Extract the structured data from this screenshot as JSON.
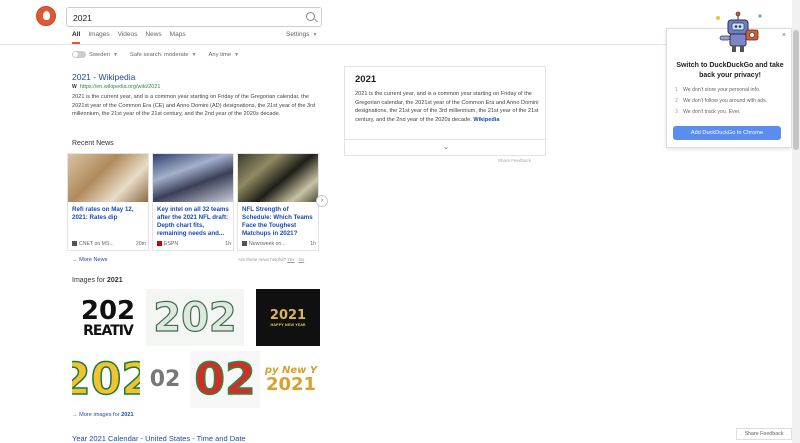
{
  "header": {
    "search_value": "2021",
    "tabs": [
      "All",
      "Images",
      "Videos",
      "News",
      "Maps"
    ],
    "settings_label": "Settings"
  },
  "filters": {
    "region": "Sweden",
    "safe_search": "Safe search: moderate",
    "time": "Any time"
  },
  "result": {
    "title": "2021 - Wikipedia",
    "url": "https://en.wikipedia.org/wiki/2021",
    "wiki_mark": "W",
    "snippet": "2021 is the current year, and is a common year starting on Friday of the Gregorian calendar, the 2021st year of the Common Era (CE) and Anno Domini (AD) designations, the 21st year of the 3rd millennium, the 21st year of the 21st century, and the 2nd year of the 2020s decade."
  },
  "news": {
    "section_title": "Recent News",
    "items": [
      {
        "title": "Refi rates on May 12, 2021: Rates dip",
        "source": "CNET on MS...",
        "age": "20m"
      },
      {
        "title": "Key intel on all 32 teams after the 2021 NFL draft: Depth chart fits, remaining needs and...",
        "source": "ESPN",
        "age": "1h"
      },
      {
        "title": "NFL Strength of Schedule: Which Teams Face the Toughest Matchups in 2021?",
        "source": "Newsweek on...",
        "age": "1h"
      }
    ],
    "more_label": "More News",
    "helpful_text": "Are these news helpful?",
    "helpful_yes": "Yes",
    "helpful_no": "No"
  },
  "images": {
    "section_prefix": "Images for ",
    "section_query": "2021",
    "more_prefix": "More images for ",
    "more_query": "2021",
    "tiles": [
      "202",
      "REATIV",
      "202",
      "2021",
      "HAPPY NEW YEAR",
      "202",
      "02",
      "02",
      "py New Y",
      "2021"
    ]
  },
  "infobox": {
    "title": "2021",
    "text": "2021 is the current year, and is a common year starting on Friday of the Gregorian calendar, the 2021st year of the Common Era and Anno Domini designations, the 21st year of the 3rd millennium, the 21st year of the 21st century, and the 2nd year of the 2020s decade.",
    "link": "Wikipedia",
    "toggle_icon": "chevron-down",
    "share_label": "Share Feedback"
  },
  "promo": {
    "title": "Switch to DuckDuckGo and take back your privacy!",
    "items": [
      {
        "num": "1",
        "text": "We don't store your personal info."
      },
      {
        "num": "2",
        "text": "We don't follow you around with ads."
      },
      {
        "num": "3",
        "text": "We don't track you. Ever."
      }
    ],
    "button_label": "Add DuckDuckGo to Chrome"
  },
  "next_result_title": "Year 2021 Calendar - United States - Time and Date",
  "share_feedback": "Share Feedback",
  "colors": {
    "accent": "#de5833",
    "link": "#1a4bb0",
    "url": "#2f8a3e",
    "button": "#5a8dee"
  }
}
